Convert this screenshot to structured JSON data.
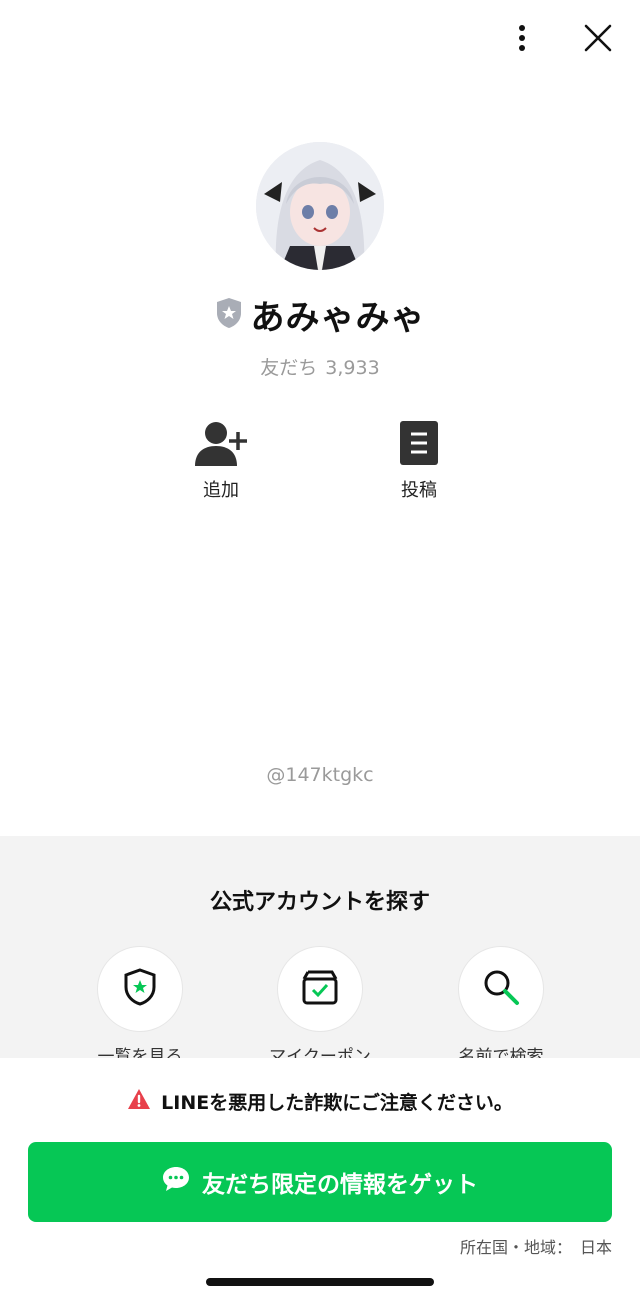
{
  "header": {
    "more_icon": "more-vertical-icon",
    "close_icon": "close-icon"
  },
  "profile": {
    "badge_icon": "verified-shield-icon",
    "name": "あみゃみゃ",
    "friends_label": "友だち",
    "friends_count": "3,933"
  },
  "actions": [
    {
      "label": "追加",
      "icon": "add-friend-icon"
    },
    {
      "label": "投稿",
      "icon": "posts-icon"
    }
  ],
  "handle": "@147ktgkc",
  "explore": {
    "title": "公式アカウントを探す",
    "items": [
      {
        "label": "一覧を見る",
        "icon": "shield-star-icon"
      },
      {
        "label": "マイクーポン",
        "icon": "coupon-box-icon"
      },
      {
        "label": "名前で検索",
        "icon": "search-icon"
      }
    ]
  },
  "sheet": {
    "warning": "LINEを悪用した詐欺にご注意ください。",
    "cta_label": "友だち限定の情報をゲット",
    "country_label": "所在国・地域：",
    "country_value": "日本"
  },
  "colors": {
    "brand_green": "#06c755",
    "warning_red": "#e8404b"
  }
}
